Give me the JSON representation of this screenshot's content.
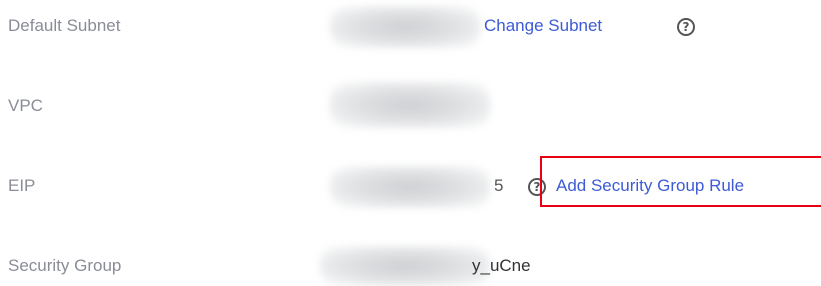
{
  "rows": {
    "default_subnet": {
      "label": "Default Subnet",
      "action": "Change Subnet",
      "help_glyph": "?"
    },
    "vpc": {
      "label": "VPC"
    },
    "eip": {
      "label": "EIP",
      "value_fragment": "5",
      "help_glyph": "?",
      "action": "Add Security Group Rule"
    },
    "security_group": {
      "label": "Security Group",
      "value_fragment": "y_uCne"
    }
  },
  "colors": {
    "label": "#8a8d96",
    "link": "#3d5bd6",
    "highlight_border": "#e60012",
    "icon": "#555555"
  },
  "icons": [
    "help-circle-icon"
  ]
}
